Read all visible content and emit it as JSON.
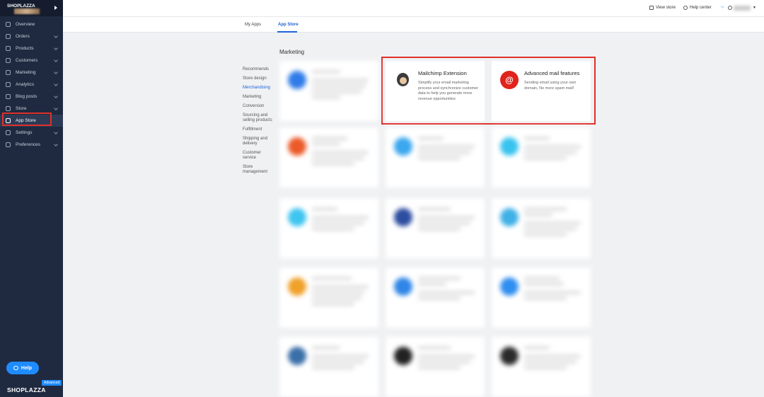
{
  "sidebar": {
    "store_name": "SHOPLAZZA",
    "items": [
      {
        "label": "Overview",
        "icon": "overview-icon"
      },
      {
        "label": "Orders",
        "icon": "orders-icon"
      },
      {
        "label": "Products",
        "icon": "products-icon"
      },
      {
        "label": "Customers",
        "icon": "customers-icon"
      },
      {
        "label": "Marketing",
        "icon": "marketing-icon"
      },
      {
        "label": "Analytics",
        "icon": "analytics-icon"
      },
      {
        "label": "Blog posts",
        "icon": "blog-icon"
      },
      {
        "label": "Store",
        "icon": "store-icon"
      },
      {
        "label": "App Store",
        "icon": "wrench-icon"
      },
      {
        "label": "Settings",
        "icon": "gear-icon"
      },
      {
        "label": "Preferences",
        "icon": "preferences-icon"
      }
    ],
    "help_label": "Help",
    "plan_badge": "Advanced",
    "logo_text": "SHOPLAZZA"
  },
  "topbar": {
    "view_store": "View store",
    "help_center": "Help center"
  },
  "tabs": [
    {
      "label": "My Apps"
    },
    {
      "label": "App Store"
    }
  ],
  "section_title": "Marketing",
  "categories": [
    "Recommends",
    "Store design",
    "Merchandising",
    "Marketing",
    "Conversion",
    "Sourcing and selling products",
    "Fulfillment",
    "Shipping and delivery",
    "Customer service",
    "Store management"
  ],
  "apps": [
    {
      "title": "Mailchimp Extension",
      "description": "Simplify your email marketing process and synchronize customer data to help you generate more revenue opportunities"
    },
    {
      "title": "Advanced mail features",
      "description": "Sending email using your own domain, No more spam mail!"
    }
  ],
  "colors": {
    "sidebar_bg": "#1f2a40",
    "accent": "#1e64d6",
    "highlight_red": "#e0302a",
    "help_blue": "#1e8bff"
  }
}
